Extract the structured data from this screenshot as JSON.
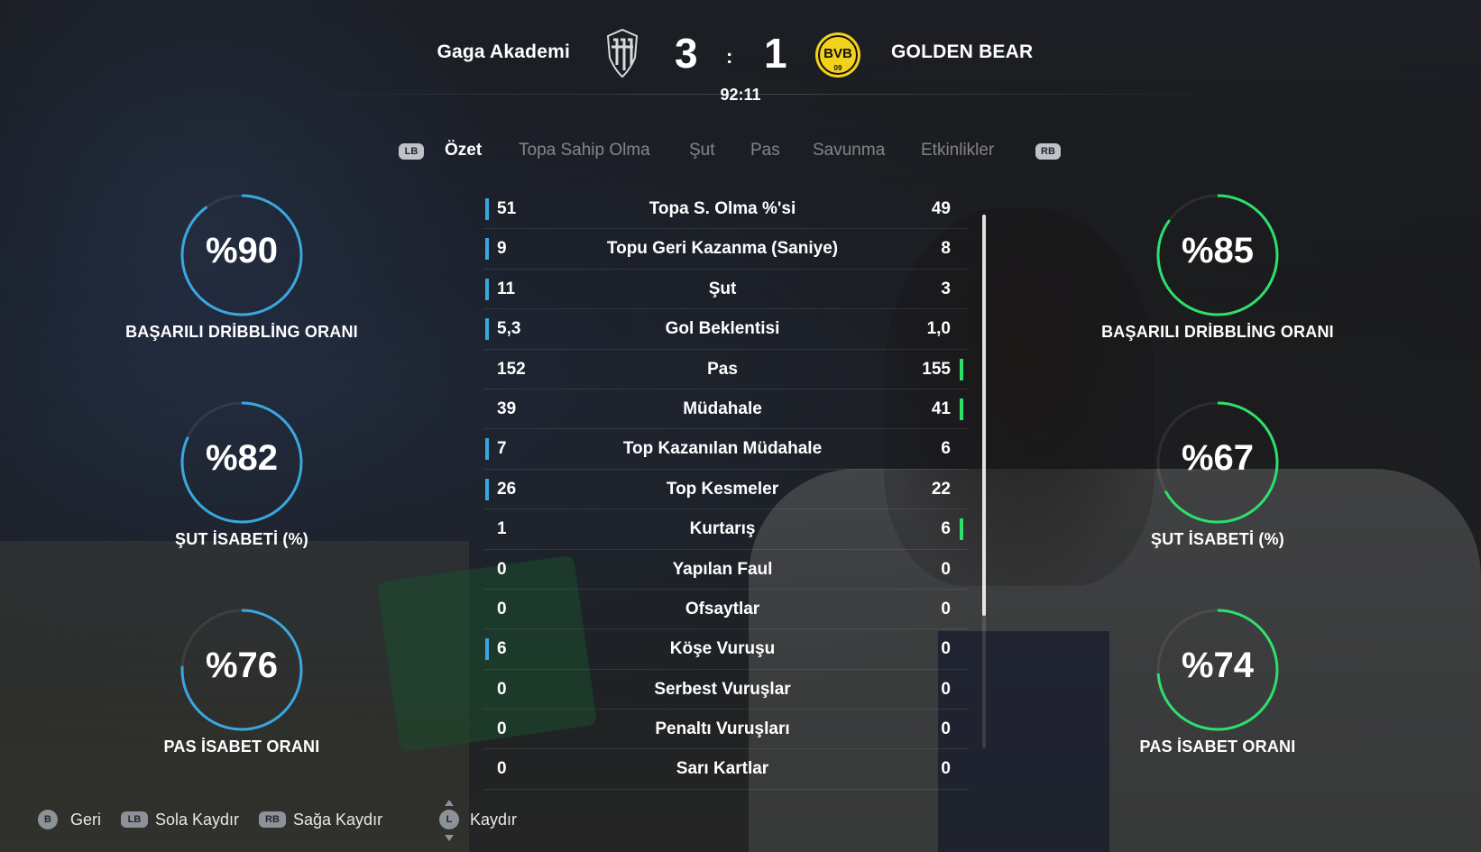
{
  "scoreboard": {
    "home_team": "Gaga Akademi",
    "away_team": "GOLDEN BEAR",
    "home_score": "3",
    "away_score": "1",
    "separator": ":",
    "clock": "92:11",
    "away_crest_text": "BVB",
    "away_crest_subtext": "09"
  },
  "tabs": {
    "prev_button": "LB",
    "next_button": "RB",
    "items": [
      "Özet",
      "Topa Sahip Olma",
      "Şut",
      "Pas",
      "Savunma",
      "Etkinlikler"
    ],
    "active": "Özet"
  },
  "stats": [
    {
      "label": "Topa S. Olma %'si",
      "home": "51",
      "away": "49",
      "leader": "home"
    },
    {
      "label": "Topu Geri Kazanma (Saniye)",
      "home": "9",
      "away": "8",
      "leader": "home"
    },
    {
      "label": "Şut",
      "home": "11",
      "away": "3",
      "leader": "home"
    },
    {
      "label": "Gol Beklentisi",
      "home": "5,3",
      "away": "1,0",
      "leader": "home"
    },
    {
      "label": "Pas",
      "home": "152",
      "away": "155",
      "leader": "away"
    },
    {
      "label": "Müdahale",
      "home": "39",
      "away": "41",
      "leader": "away"
    },
    {
      "label": "Top Kazanılan Müdahale",
      "home": "7",
      "away": "6",
      "leader": "home"
    },
    {
      "label": "Top Kesmeler",
      "home": "26",
      "away": "22",
      "leader": "home"
    },
    {
      "label": "Kurtarış",
      "home": "1",
      "away": "6",
      "leader": "away"
    },
    {
      "label": "Yapılan Faul",
      "home": "0",
      "away": "0",
      "leader": "none"
    },
    {
      "label": "Ofsaytlar",
      "home": "0",
      "away": "0",
      "leader": "none"
    },
    {
      "label": "Köşe Vuruşu",
      "home": "6",
      "away": "0",
      "leader": "home"
    },
    {
      "label": "Serbest Vuruşlar",
      "home": "0",
      "away": "0",
      "leader": "none"
    },
    {
      "label": "Penaltı Vuruşları",
      "home": "0",
      "away": "0",
      "leader": "none"
    },
    {
      "label": "Sarı Kartlar",
      "home": "0",
      "away": "0",
      "leader": "none"
    }
  ],
  "home_rings": [
    {
      "value": "%90",
      "fraction": 0.9,
      "label": "BAŞARILI DRİBBLİNG ORANI"
    },
    {
      "value": "%82",
      "fraction": 0.82,
      "label": "ŞUT İSABETİ (%)"
    },
    {
      "value": "%76",
      "fraction": 0.76,
      "label": "PAS İSABET ORANI"
    }
  ],
  "away_rings": [
    {
      "value": "%85",
      "fraction": 0.85,
      "label": "BAŞARILI DRİBBLİNG ORANI"
    },
    {
      "value": "%67",
      "fraction": 0.67,
      "label": "ŞUT İSABETİ (%)"
    },
    {
      "value": "%74",
      "fraction": 0.74,
      "label": "PAS İSABET ORANI"
    }
  ],
  "colors": {
    "home": "#3aa7e0",
    "away": "#2ee06a"
  },
  "footer": {
    "back_button": "B",
    "back_label": "Geri",
    "left_button": "LB",
    "left_label": "Sola Kaydır",
    "right_button": "RB",
    "right_label": "Sağa Kaydır",
    "scroll_button": "L",
    "scroll_label": "Kaydır"
  }
}
